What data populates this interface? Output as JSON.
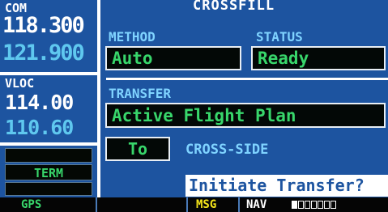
{
  "com": {
    "label": "COM",
    "active": "118.300",
    "standby": "121.900"
  },
  "vloc": {
    "label": "VLOC",
    "active": "114.00",
    "standby": "110.60"
  },
  "left_softkey": {
    "term_label": "TERM"
  },
  "page": {
    "title": "CROSSFILL"
  },
  "method": {
    "label": "METHOD",
    "value": "Auto"
  },
  "status": {
    "label": "STATUS",
    "value": "Ready"
  },
  "transfer": {
    "label": "TRANSFER",
    "value": "Active Flight Plan"
  },
  "direction": {
    "value": "To",
    "label": "CROSS-SIDE"
  },
  "action": {
    "prompt": "Initiate Transfer?"
  },
  "status_bar": {
    "mode": "GPS",
    "msg": "MSG",
    "nav": "NAV"
  },
  "colors": {
    "background": "#1d54a0",
    "field_text": "#38d66b",
    "label_cyan": "#7fd3ff",
    "msg_yellow": "#f5e51a"
  }
}
